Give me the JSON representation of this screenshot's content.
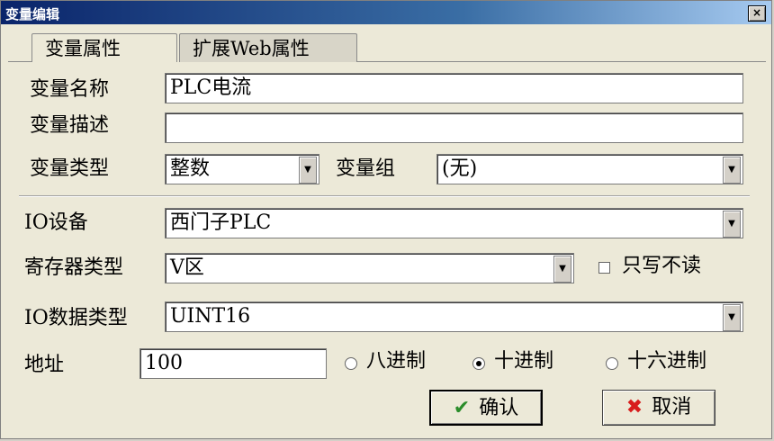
{
  "window": {
    "title": "变量编辑",
    "close_glyph": "×"
  },
  "tabs": [
    {
      "label": "变量属性",
      "active": true
    },
    {
      "label": "扩展Web属性",
      "active": false
    }
  ],
  "form": {
    "var_name_label": "变量名称",
    "var_name_value": "PLC电流",
    "var_desc_label": "变量描述",
    "var_desc_value": "",
    "var_type_label": "变量类型",
    "var_type_value": "整数",
    "var_group_label": "变量组",
    "var_group_value": "(无)",
    "io_device_label": "IO设备",
    "io_device_value": "西门子PLC",
    "register_type_label": "寄存器类型",
    "register_type_value": "V区",
    "write_only_label": "只写不读",
    "write_only_checked": false,
    "io_data_type_label": "IO数据类型",
    "io_data_type_value": "UINT16",
    "address_label": "地址",
    "address_value": "100",
    "radix": {
      "octal_label": "八进制",
      "decimal_label": "十进制",
      "hex_label": "十六进制",
      "selected": "decimal"
    },
    "dropdown_glyph": "▼"
  },
  "buttons": {
    "ok_label": "确认",
    "cancel_label": "取消",
    "ok_icon": "check-icon",
    "cancel_icon": "cross-icon",
    "ok_glyph": "✔",
    "cancel_glyph": "✖"
  }
}
